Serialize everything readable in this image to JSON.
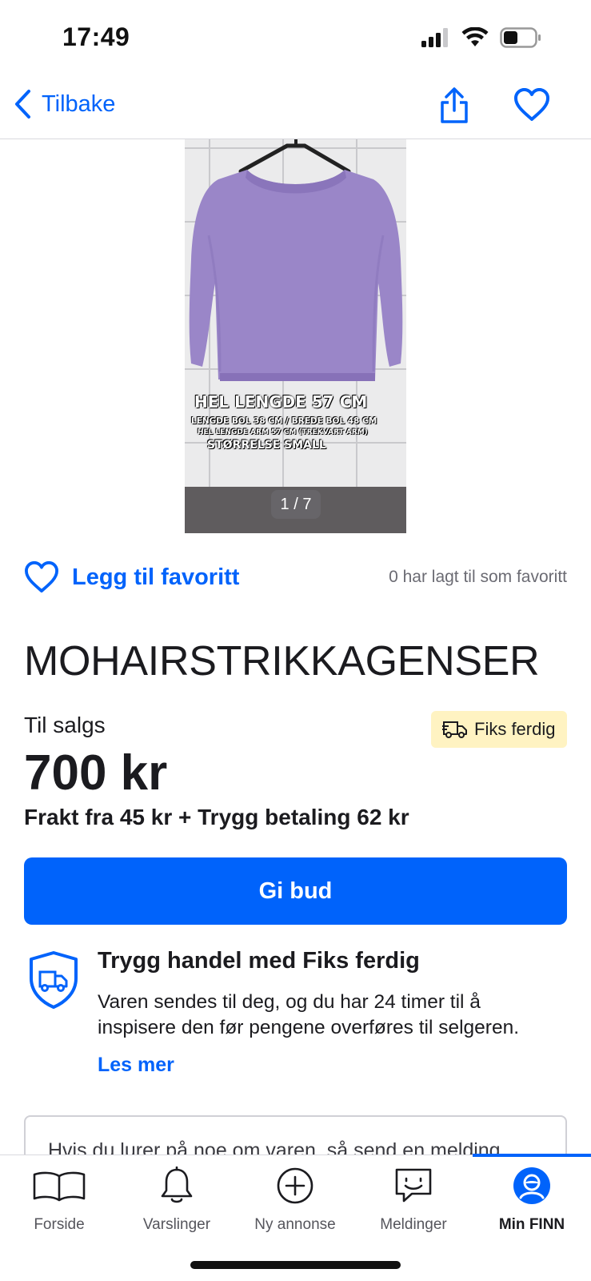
{
  "status_bar": {
    "time": "17:49"
  },
  "nav": {
    "back_label": "Tilbake"
  },
  "gallery": {
    "counter": "1 / 7",
    "caption": {
      "line1": "HEL LENGDE 57 CM",
      "line2": "LENGDE BOL 38 CM / BREDE BOL 48 CM",
      "line3": "HEL LENGDE ARM 57 CM (TREKVART ARM)",
      "line4": "STØRRELSE SMALL"
    }
  },
  "favorite": {
    "label": "Legg til favoritt",
    "count_text": "0 har lagt til som favoritt"
  },
  "listing": {
    "title": "MOHAIRSTRIKKAGENSER",
    "status": "Til salgs",
    "badge": "Fiks ferdig",
    "price": "700 kr",
    "shipping": "Frakt fra 45 kr + Trygg betaling 62 kr",
    "bid_button": "Gi bud"
  },
  "safe_trade": {
    "title": "Trygg handel med Fiks ferdig",
    "text": "Varen sendes til deg, og du har 24 timer til å inspisere den før pengene overføres til selgeren.",
    "read_more": "Les mer"
  },
  "message": {
    "text": "Hvis du lurer på noe om varen, så send en melding"
  },
  "tabs": [
    {
      "label": "Forside",
      "icon": "book-icon"
    },
    {
      "label": "Varslinger",
      "icon": "bell-icon"
    },
    {
      "label": "Ny annonse",
      "icon": "plus-circle-icon"
    },
    {
      "label": "Meldinger",
      "icon": "chat-icon"
    },
    {
      "label": "Min FINN",
      "icon": "profile-icon"
    }
  ],
  "colors": {
    "accent": "#0063fb",
    "badge_bg": "#fff3c2",
    "sweater": "#9a86c8"
  }
}
